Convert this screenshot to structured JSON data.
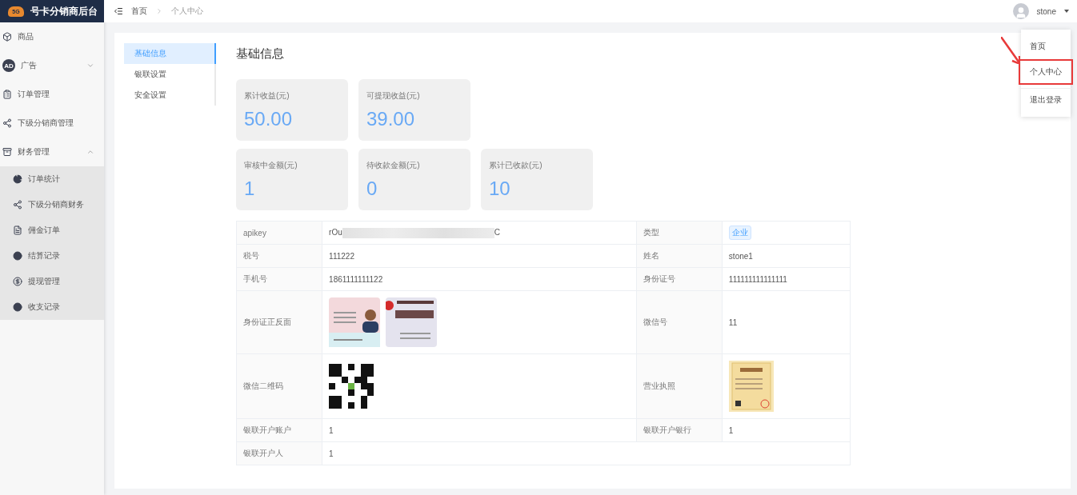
{
  "brand": {
    "logo_text": "5G",
    "title": "号卡分销商后台"
  },
  "sidebar": {
    "items": [
      {
        "label": "商品"
      },
      {
        "label": "广告",
        "icon_text": "AD",
        "expanded": false
      },
      {
        "label": "订单管理"
      },
      {
        "label": "下级分销商管理"
      },
      {
        "label": "财务管理",
        "expanded": true,
        "children": [
          {
            "label": "订单统计"
          },
          {
            "label": "下级分销商财务"
          },
          {
            "label": "佣金订单"
          },
          {
            "label": "结算记录"
          },
          {
            "label": "提现管理"
          },
          {
            "label": "收支记录"
          }
        ]
      }
    ]
  },
  "breadcrumb": [
    "首页",
    "个人中心"
  ],
  "user": {
    "name": "stone",
    "menu": [
      {
        "label": "首页",
        "selected": false
      },
      {
        "label": "个人中心",
        "selected": true
      },
      {
        "label": "退出登录",
        "selected": false
      }
    ]
  },
  "tabs": [
    {
      "label": "基础信息",
      "selected": true
    },
    {
      "label": "银联设置",
      "selected": false
    },
    {
      "label": "安全设置",
      "selected": false
    }
  ],
  "section_title": "基础信息",
  "stat_rows": [
    [
      {
        "label": "累计收益(元)",
        "value": "50.00"
      },
      {
        "label": "可提现收益(元)",
        "value": "39.00"
      }
    ],
    [
      {
        "label": "审核中金额(元)",
        "value": "1"
      },
      {
        "label": "待收款金额(元)",
        "value": "0"
      },
      {
        "label": "累计已收款(元)",
        "value": "10"
      }
    ]
  ],
  "table": {
    "rows": [
      [
        {
          "label": "apikey",
          "kind": "masked",
          "start": "rOu",
          "end": "C"
        },
        {
          "label": "类型",
          "kind": "tag",
          "text": "企业"
        }
      ],
      [
        {
          "label": "税号",
          "kind": "text",
          "text": "111222"
        },
        {
          "label": "姓名",
          "kind": "text",
          "text": "stone1"
        }
      ],
      [
        {
          "label": "手机号",
          "kind": "text",
          "text": "1861111111122"
        },
        {
          "label": "身份证号",
          "kind": "text",
          "text": "111111111111111"
        }
      ],
      [
        {
          "label": "身份证正反面",
          "kind": "id_card_photos"
        },
        {
          "label": "微信号",
          "kind": "text",
          "text": "11"
        }
      ],
      [
        {
          "label": "微信二维码",
          "kind": "qr_code"
        },
        {
          "label": "营业执照",
          "kind": "license_photo"
        }
      ],
      [
        {
          "label": "银联开户账户",
          "kind": "text",
          "text": "1"
        },
        {
          "label": "银联开户银行",
          "kind": "text",
          "text": "1"
        }
      ],
      [
        {
          "label": "银联开户人",
          "kind": "text",
          "text": "1"
        }
      ]
    ]
  }
}
